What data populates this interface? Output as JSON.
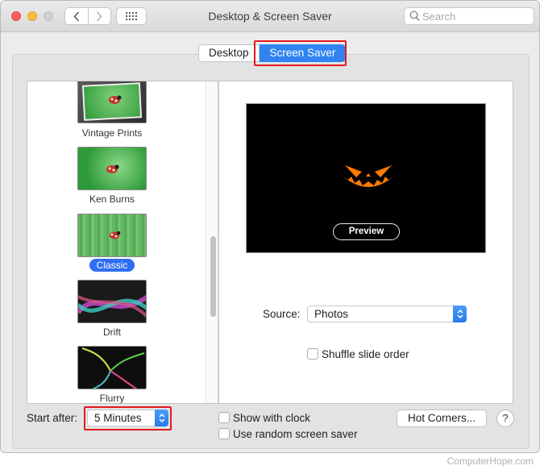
{
  "window": {
    "title": "Desktop & Screen Saver"
  },
  "search": {
    "placeholder": "Search"
  },
  "tabs": [
    {
      "label": "Desktop",
      "active": false
    },
    {
      "label": "Screen Saver",
      "active": true
    }
  ],
  "savers": [
    {
      "name": "Vintage Prints",
      "selected": false
    },
    {
      "name": "Ken Burns",
      "selected": false
    },
    {
      "name": "Classic",
      "selected": true
    },
    {
      "name": "Drift",
      "selected": false
    },
    {
      "name": "Flurry",
      "selected": false
    }
  ],
  "preview": {
    "button_label": "Preview"
  },
  "options": {
    "source_label": "Source:",
    "source_value": "Photos",
    "shuffle_label": "Shuffle slide order",
    "shuffle_checked": false
  },
  "footer": {
    "start_after_label": "Start after:",
    "start_after_value": "5 Minutes",
    "show_clock_label": "Show with clock",
    "show_clock_checked": false,
    "random_label": "Use random screen saver",
    "random_checked": false,
    "hot_corners_label": "Hot Corners...",
    "help_label": "?"
  },
  "watermark": "ComputerHope.com",
  "colors": {
    "accent": "#2f84f2",
    "highlight_box": "#e4191f",
    "pumpkin": "#ff7a00"
  }
}
